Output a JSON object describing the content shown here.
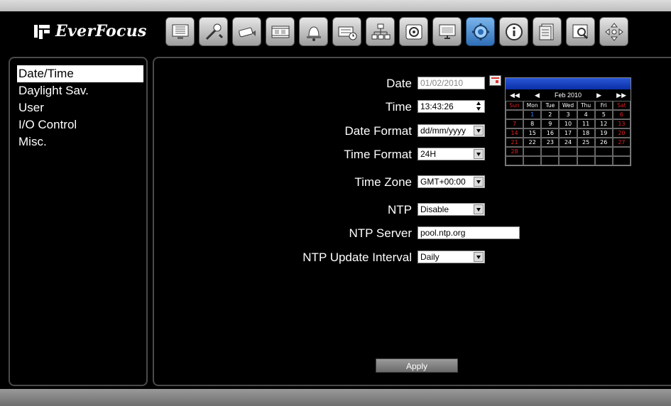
{
  "brand": {
    "name": "EverFocus"
  },
  "toolbar": {
    "buttons": [
      {
        "icon": "monitor-grid-icon"
      },
      {
        "icon": "tools-icon"
      },
      {
        "icon": "camera-icon"
      },
      {
        "icon": "film-icon"
      },
      {
        "icon": "alarm-bell-icon"
      },
      {
        "icon": "schedule-icon"
      },
      {
        "icon": "network-icon"
      },
      {
        "icon": "disk-icon"
      },
      {
        "icon": "display-icon"
      },
      {
        "icon": "system-settings-icon",
        "active": true
      },
      {
        "icon": "info-icon"
      },
      {
        "icon": "event-log-icon"
      },
      {
        "icon": "search-icon"
      },
      {
        "icon": "ptz-arrows-icon"
      }
    ]
  },
  "menu": {
    "items": [
      "Date/Time",
      "Daylight Sav.",
      "User",
      "I/O Control",
      "Misc."
    ],
    "selected": "Date/Time"
  },
  "form": {
    "date": {
      "label": "Date",
      "value": "01/02/2010"
    },
    "time": {
      "label": "Time",
      "value": "13:43:26"
    },
    "date_format": {
      "label": "Date Format",
      "value": "dd/mm/yyyy"
    },
    "time_format": {
      "label": "Time Format",
      "value": "24H"
    },
    "time_zone": {
      "label": "Time Zone",
      "value": "GMT+00:00"
    },
    "ntp": {
      "label": "NTP",
      "value": "Disable"
    },
    "ntp_server": {
      "label": "NTP Server",
      "value": "pool.ntp.org"
    },
    "ntp_interval": {
      "label": "NTP Update Interval",
      "value": "Daily"
    }
  },
  "calendar": {
    "month_label": "Feb 2010",
    "nav_prev_year": "◀◀",
    "nav_prev": "◀",
    "nav_next": "▶",
    "nav_next_year": "▶▶",
    "weekdays": [
      "Sun",
      "Mon",
      "Tue",
      "Wed",
      "Thu",
      "Fri",
      "Sat"
    ],
    "weeks": [
      [
        "",
        "1",
        "2",
        "3",
        "4",
        "5",
        "6"
      ],
      [
        "7",
        "8",
        "9",
        "10",
        "11",
        "12",
        "13"
      ],
      [
        "14",
        "15",
        "16",
        "17",
        "18",
        "19",
        "20"
      ],
      [
        "21",
        "22",
        "23",
        "24",
        "25",
        "26",
        "27"
      ],
      [
        "28",
        "",
        "",
        "",
        "",
        "",
        ""
      ],
      [
        "",
        "",
        "",
        "",
        "",
        "",
        ""
      ]
    ],
    "today": "1"
  },
  "apply_label": "Apply",
  "colors": {
    "active_tool": "#3f84d0",
    "weekend": "#d22222",
    "calendar_header": "#0a2fa8"
  }
}
